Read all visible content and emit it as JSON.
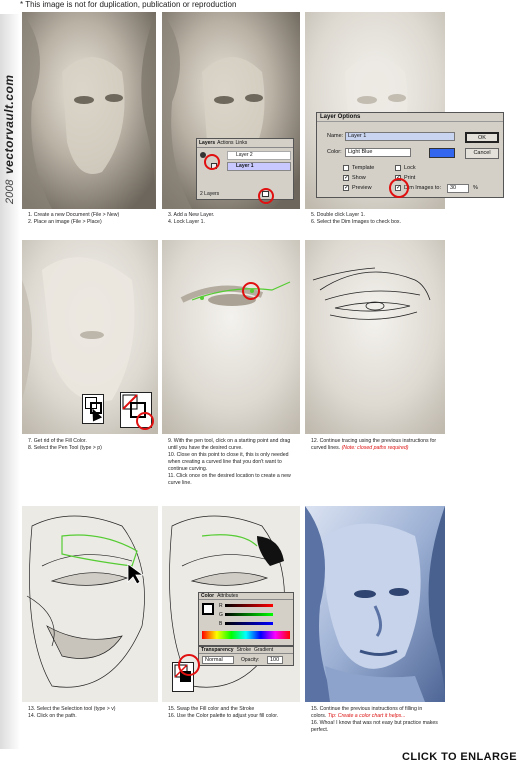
{
  "notice": "* This image is not for duplication, publication or reproduction",
  "side": {
    "brand": "vectorvault.com",
    "year": "2008"
  },
  "steps": [
    {
      "lines": [
        "1. Create a new Document (File > New)",
        "2. Place an image (File > Place)"
      ]
    },
    {
      "lines": [
        "3. Add a New Layer.",
        "4. Lock Layer 1."
      ]
    },
    {
      "lines": [
        "5. Double click Layer 1.",
        "6. Select the Dim Images to check box."
      ]
    },
    {
      "lines": [
        "7. Get rid of the Fill Color.",
        "8. Select the Pen Tool (type > p)"
      ]
    },
    {
      "lines": [
        "9. With the pen tool, click on a starting point and drag",
        "until you have the desired curve.",
        "10. Close on this point to close it, this is only needed",
        "when creating a curved line that you don't want to",
        "continue curving.",
        "11. Click once on the desired location to create a new",
        "curve line."
      ]
    },
    {
      "lines": [
        "12. Continue tracing using the previous instructions for",
        "curved lines."
      ],
      "note": "(Note: closed paths required)"
    },
    {
      "lines": [
        "13. Select the Selection tool (type > v)",
        "14. Click on the path."
      ]
    },
    {
      "lines": [
        "15. Swap the Fill color and the Stroke",
        "16. Use the Color palette to adjust your fill color."
      ]
    },
    {
      "lines": [
        "15. Continue the previous instructions of filling in",
        "colors."
      ],
      "tip": "Tip: Create a color chart it helps...",
      "lines2": [
        "16. Whoa! I know that was not easy but practice makes",
        "perfect."
      ]
    }
  ],
  "layers_palette": {
    "tabs": [
      "Layers",
      "Actions",
      "Links"
    ],
    "rows": [
      "Layer 2",
      "Layer 1"
    ],
    "footer": "2 Layers"
  },
  "layer_options": {
    "title": "Layer Options",
    "name_label": "Name:",
    "name_value": "Layer 1",
    "color_label": "Color:",
    "color_value": "Light Blue",
    "ok": "OK",
    "cancel": "Cancel",
    "checks": [
      "Template",
      "Lock",
      "Show",
      "Print",
      "Preview",
      "Dim Images to:"
    ],
    "dim_value": "30",
    "percent": "%"
  },
  "color_palette": {
    "tabs": [
      "Color",
      "Attributes"
    ],
    "channels": [
      "R",
      "G",
      "B"
    ],
    "transparency_tabs": [
      "Transparency",
      "Stroke",
      "Gradient"
    ],
    "blend_mode": "Normal",
    "opacity_label": "Opacity:",
    "opacity_value": "100"
  },
  "enlarge": "CLICK TO ENLARGE",
  "colors": {
    "accent": "#e01010",
    "path_green": "#55cc33",
    "blue_swatch": "#3366ee"
  }
}
